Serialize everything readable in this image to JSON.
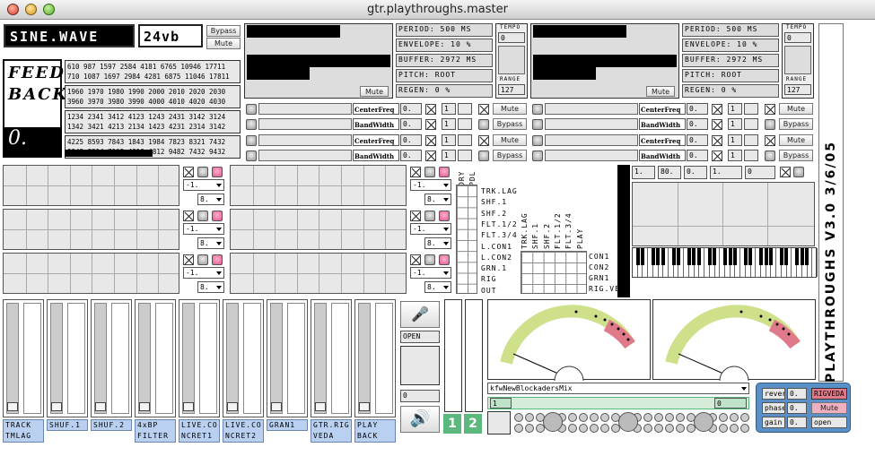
{
  "window": {
    "title": "gtr.playthroughs.master"
  },
  "top": {
    "sine": "SINE.WAVE",
    "vb": "24vb",
    "bypass": "Bypass",
    "mute": "Mute",
    "feedback": "FEED\nBACK",
    "zero": "0."
  },
  "numbers": [
    "610 987 1597 2584 4181 6765 10946 17711",
    "710 1087 1697 2984 4281 6875 11046 17811",
    "1960 1970 1980 1990 2000 2010 2020 2030",
    "3960 3970 3980 3990 4000 4010 4020 4030",
    "1234 2341 3412 4123 1243 2431 3142 3124",
    "1342 3421 4213 2134 1423 4231 2314 3142",
    "4225 8593 7843 1843 1984 7823 8321 7432",
    "9843 8214 7105 4918 4812 9482 7432 9432"
  ],
  "delays": [
    {
      "period": "PERIOD: 500 MS",
      "env": "ENVELOPE: 10 %",
      "buffer": "BUFFER: 2972 MS",
      "pitch": "PITCH: ROOT",
      "regen": "REGEN: 0 %",
      "tempo": "TEMPO",
      "tempo_val": "0",
      "range": "RANGE",
      "range_val": "127",
      "mute": "Mute"
    },
    {
      "period": "PERIOD: 500 MS",
      "env": "ENVELOPE: 10 %",
      "buffer": "BUFFER: 2972 MS",
      "pitch": "PITCH: ROOT",
      "regen": "REGEN: 0 %",
      "tempo": "TEMPO",
      "tempo_val": "0",
      "range": "RANGE",
      "range_val": "127",
      "mute": "Mute"
    }
  ],
  "filters": {
    "centerfreq": "CenterFreq",
    "bandwidth": "BandWidth",
    "zero": "0.",
    "one": "1",
    "mute": "Mute",
    "bypass": "Bypass"
  },
  "seq": {
    "minus1": "-1.",
    "eight": "8."
  },
  "matrix": {
    "dry": "DRY",
    "pdl": "PDL",
    "rows": [
      "TRK.LAG",
      "SHF.1",
      "SHF.2",
      "FLT.1/2",
      "FLT.3/4",
      "L.CON1",
      "L.CON2",
      "GRN.1",
      "RIG",
      "OUT"
    ],
    "cols": [
      "TRK.LAG",
      "SHF.1",
      "SHF.2",
      "FLT.1/2",
      "FLT.3/4",
      "PLAY"
    ],
    "rows2": [
      "CON1",
      "CON2",
      "GRN1",
      "RIG.VED"
    ]
  },
  "keys": {
    "vals": [
      "1.",
      "80.",
      "0.",
      "1.",
      "0"
    ]
  },
  "side": "PLAYTHROUGHS V3.0 3/6/05",
  "faders": [
    "TRACK\nTMLAG",
    "SHUF.1",
    "SHUF.2",
    "4xBP\nFILTER",
    "LIVE.CO\nNCRET1",
    "LIVE.CO\nNCRET2",
    "GRAN1",
    "GTR.RIG\nVEDA",
    "PLAY\nBACK"
  ],
  "mic": {
    "open": "OPEN",
    "zero": "0"
  },
  "outs": [
    "1",
    "2"
  ],
  "player": {
    "file": "kfwNewBlockadersMix",
    "one": "1",
    "zero": "0"
  },
  "rig": {
    "reverb": "reverb",
    "phase": "phase",
    "gain": "gain",
    "zero": "0.",
    "name": "RIGVEDA",
    "mute": "Mute",
    "open": "open"
  },
  "colors": {
    "green": "#5db87d",
    "pink": "#e07a8a",
    "blue": "#b9d0f0"
  }
}
